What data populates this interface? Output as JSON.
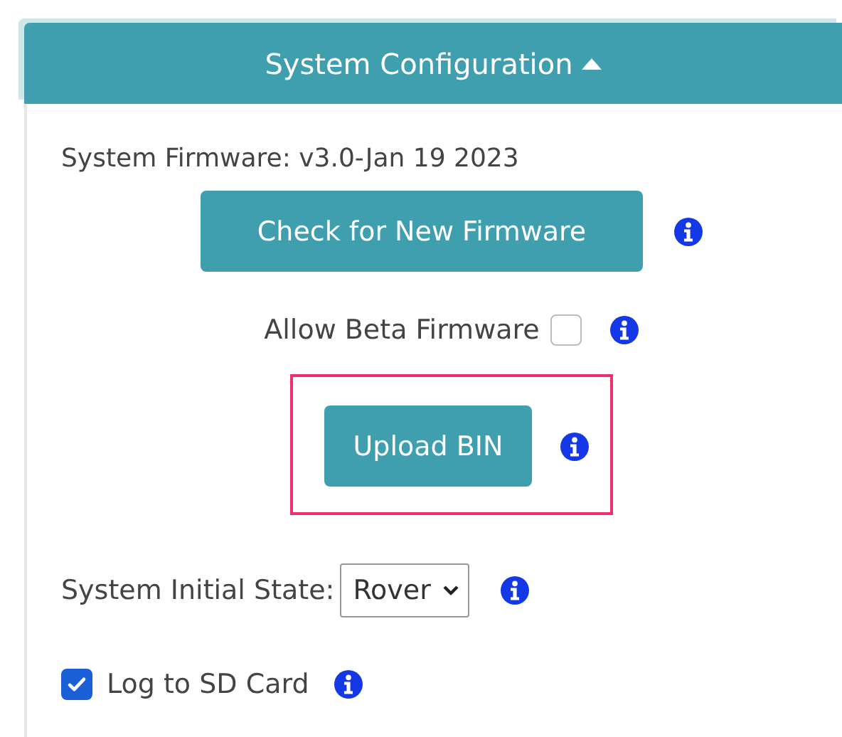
{
  "panel": {
    "title": "System Configuration",
    "expanded": true
  },
  "firmware": {
    "label": "System Firmware: v3.0-Jan 19 2023"
  },
  "check_button": {
    "label": "Check for New Firmware"
  },
  "beta": {
    "label": "Allow Beta Firmware",
    "checked": false
  },
  "upload": {
    "label": "Upload BIN",
    "highlighted": true
  },
  "initial_state": {
    "label": "System Initial State:",
    "value": "Rover"
  },
  "log": {
    "label": "Log to SD Card",
    "checked": true
  }
}
